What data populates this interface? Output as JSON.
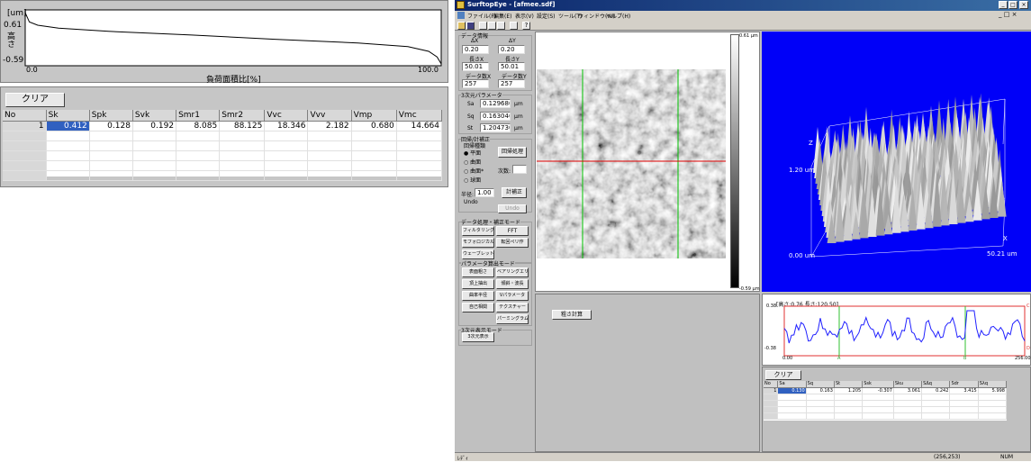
{
  "left": {
    "y_unit": "[um]",
    "y_max": "0.61",
    "y_label": "高さ",
    "y_min": "-0.59",
    "x_min": "0.0",
    "x_max": "100.0",
    "x_label": "負荷面積比[%]",
    "clear_label": "クリア",
    "table": {
      "headers": [
        "No",
        "Sk",
        "Spk",
        "Svk",
        "Smr1",
        "Smr2",
        "Vvc",
        "Vvv",
        "Vmp",
        "Vmc"
      ],
      "rows": [
        [
          "1",
          "0.412",
          "0.128",
          "0.192",
          "8.085",
          "88.125",
          "18.346",
          "2.182",
          "0.680",
          "14.664"
        ]
      ]
    }
  },
  "chart_data": {
    "type": "line",
    "title": "",
    "xlabel": "負荷面積比[%]",
    "ylabel": "高さ",
    "xlim": [
      0,
      100
    ],
    "ylim": [
      -0.59,
      0.61
    ],
    "series": [
      {
        "x": [
          0,
          1,
          3,
          8,
          20,
          40,
          60,
          80,
          92,
          97,
          99,
          100
        ],
        "y": [
          0.55,
          0.35,
          0.28,
          0.22,
          0.15,
          0.07,
          -0.02,
          -0.1,
          -0.18,
          -0.28,
          -0.4,
          -0.55
        ]
      }
    ]
  },
  "app": {
    "title": "SurftopEye - [afmee.sdf]",
    "menu": [
      "ファイル(F)",
      "編集(E)",
      "表示(V)",
      "設定(S)",
      "ツール(T)",
      "ウィンドウ(W)",
      "ヘルプ(H)"
    ],
    "data_info": {
      "title": "データ情報",
      "dx_label": "ΔX",
      "dx": "0.20",
      "dy_label": "ΔY",
      "dy": "0.20",
      "lx_label": "長さX",
      "lx": "50.01",
      "ly_label": "長さY",
      "ly": "50.01",
      "nx_label": "データ数X",
      "nx": "257",
      "ny_label": "データ数Y",
      "ny": "257"
    },
    "params3d": {
      "title": "3次元パラメータ",
      "sa_label": "Sa",
      "sa": "0.129686",
      "sq_label": "Sq",
      "sq": "0.163046",
      "st_label": "St",
      "st": "1.204730",
      "unit": "μm"
    },
    "correction": {
      "title": "回帰/計補正",
      "type_label": "回帰種類",
      "options": [
        "平面",
        "曲面",
        "曲面*",
        "球面"
      ],
      "regress_btn": "回帰処理",
      "order_label": "次数:",
      "radius_label": "半径:",
      "radius": "1.00",
      "calc_btn": "計補正",
      "undo_label": "Undo",
      "undo_btn": "Undo"
    },
    "data_proc": {
      "title": "データ処理・補正モード",
      "buttons": [
        "フィルタリング",
        "FFT",
        "モフォロジカル",
        "転回ペリ作",
        "ウェーブレット"
      ]
    },
    "param_mode": {
      "title": "パラメータ算出モード",
      "buttons": [
        "表面粗さ",
        "ベアリングエリア",
        "頂上抽出",
        "傾斜・波長",
        "曲率半径",
        "Vパラメータ",
        "自己相関",
        "テクスチャー",
        "",
        "パーミングラム"
      ]
    },
    "view_mode": {
      "title": "3次元表示モード",
      "button": "3次元表示"
    },
    "image": {
      "scale_top": "0.61 μm",
      "scale_bottom": "-0.59 μm"
    },
    "view3d": {
      "z_label": "Z",
      "z_max": "1.20 um",
      "z_min": "0.00 um",
      "x_label": "X",
      "x_max": "50.21 um"
    },
    "measure_btn": "粗さ計算",
    "profile": {
      "header": "[高さ:0.76 長さ:120.50]",
      "y_max": "0.38",
      "y_min": "-0.38",
      "x_min": "0.00",
      "x_max": "256.00",
      "marker_a": "A",
      "marker_b": "B",
      "right_c": "C",
      "right_d": "D"
    },
    "rough_table": {
      "clear_label": "クリア",
      "headers": [
        "No",
        "Sa",
        "Sq",
        "St",
        "Ssk",
        "Sku",
        "SΔq",
        "Sdr",
        "Sλq"
      ],
      "rows": [
        [
          "1",
          "0.130",
          "0.163",
          "1.205",
          "-0.307",
          "3.061",
          "0.242",
          "3.415",
          "5.998"
        ]
      ]
    },
    "status": {
      "left": "ﾚﾃﾞｨ",
      "coords": "(256,253)",
      "num": "NUM"
    }
  }
}
